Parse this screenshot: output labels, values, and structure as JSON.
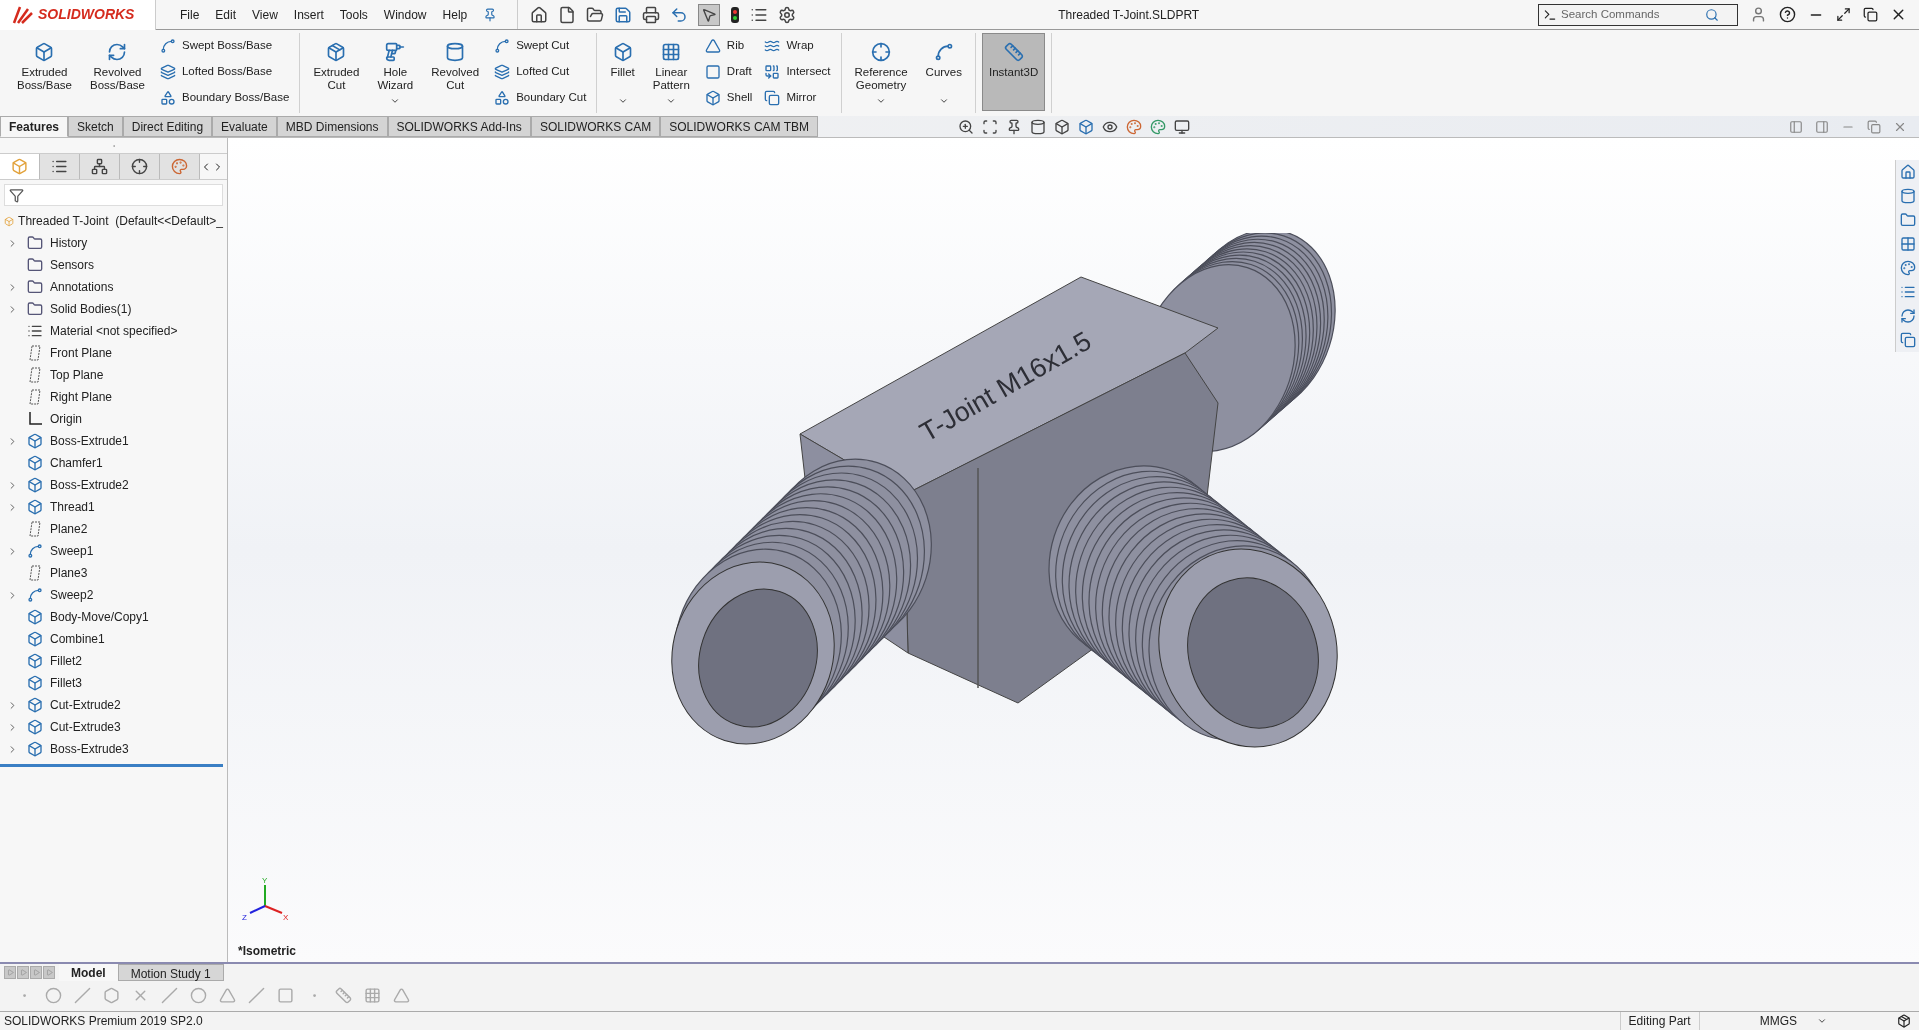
{
  "title_bar": {
    "logo_text": "SOLIDWORKS",
    "menus": [
      "File",
      "Edit",
      "View",
      "Insert",
      "Tools",
      "Window",
      "Help"
    ],
    "document_title": "Threaded T-Joint.SLDPRT",
    "search": {
      "placeholder": "Search Commands"
    }
  },
  "ribbon_groups": [
    [
      {
        "kind": "large",
        "label": "Extruded\nBoss/Base",
        "dropdown": false,
        "selected": false
      },
      {
        "kind": "large",
        "label": "Revolved\nBoss/Base",
        "dropdown": false,
        "selected": false
      },
      {
        "kind": "stack",
        "items": [
          "Swept Boss/Base",
          "Lofted Boss/Base",
          "Boundary Boss/Base"
        ]
      }
    ],
    [
      {
        "kind": "large",
        "label": "Extruded\nCut",
        "dropdown": false,
        "selected": false
      },
      {
        "kind": "large",
        "label": "Hole\nWizard",
        "dropdown": true,
        "selected": false
      },
      {
        "kind": "large",
        "label": "Revolved\nCut",
        "dropdown": false,
        "selected": false
      },
      {
        "kind": "stack",
        "items": [
          "Swept Cut",
          "Lofted Cut",
          "Boundary Cut"
        ]
      }
    ],
    [
      {
        "kind": "large",
        "label": "Fillet",
        "dropdown": true,
        "selected": false
      },
      {
        "kind": "large",
        "label": "Linear\nPattern",
        "dropdown": true,
        "selected": false
      },
      {
        "kind": "stack",
        "items": [
          "Rib",
          "Draft",
          "Shell"
        ]
      },
      {
        "kind": "stack",
        "items": [
          "Wrap",
          "Intersect",
          "Mirror"
        ]
      }
    ],
    [
      {
        "kind": "large",
        "label": "Reference\nGeometry",
        "dropdown": true,
        "selected": false
      },
      {
        "kind": "large",
        "label": "Curves",
        "dropdown": true,
        "selected": false
      }
    ],
    [
      {
        "kind": "large",
        "label": "Instant3D",
        "dropdown": false,
        "selected": true
      }
    ]
  ],
  "command_tabs": [
    {
      "label": "Features",
      "selected": true
    },
    {
      "label": "Sketch",
      "selected": false
    },
    {
      "label": "Direct Editing",
      "selected": false
    },
    {
      "label": "Evaluate",
      "selected": false
    },
    {
      "label": "MBD Dimensions",
      "selected": false
    },
    {
      "label": "SOLIDWORKS Add-Ins",
      "selected": false
    },
    {
      "label": "SOLIDWORKS CAM",
      "selected": false
    },
    {
      "label": "SOLIDWORKS CAM TBM",
      "selected": false
    }
  ],
  "feature_tree": {
    "panel_tabs": [
      {
        "selected": true
      },
      {
        "selected": false
      },
      {
        "selected": false
      },
      {
        "selected": false
      },
      {
        "selected": false
      }
    ],
    "root": "Threaded T-Joint  (Default<<Default>_",
    "items": [
      {
        "label": "History",
        "kind": "folder",
        "has_children": true
      },
      {
        "label": "Sensors",
        "kind": "folder",
        "has_children": false
      },
      {
        "label": "Annotations",
        "kind": "folder",
        "has_children": true
      },
      {
        "label": "Solid Bodies(1)",
        "kind": "folder",
        "has_children": true
      },
      {
        "label": "Material <not specified>",
        "kind": "material",
        "has_children": false
      },
      {
        "label": "Front Plane",
        "kind": "plane",
        "has_children": false
      },
      {
        "label": "Top Plane",
        "kind": "plane",
        "has_children": false
      },
      {
        "label": "Right Plane",
        "kind": "plane",
        "has_children": false
      },
      {
        "label": "Origin",
        "kind": "origin",
        "has_children": false
      },
      {
        "label": "Boss-Extrude1",
        "kind": "feature",
        "has_children": true
      },
      {
        "label": "Chamfer1",
        "kind": "feature",
        "has_children": false
      },
      {
        "label": "Boss-Extrude2",
        "kind": "feature",
        "has_children": true
      },
      {
        "label": "Thread1",
        "kind": "feature",
        "has_children": true
      },
      {
        "label": "Plane2",
        "kind": "plane",
        "has_children": false
      },
      {
        "label": "Sweep1",
        "kind": "sweep",
        "has_children": true
      },
      {
        "label": "Plane3",
        "kind": "plane",
        "has_children": false
      },
      {
        "label": "Sweep2",
        "kind": "sweep",
        "has_children": true
      },
      {
        "label": "Body-Move/Copy1",
        "kind": "feature",
        "has_children": false
      },
      {
        "label": "Combine1",
        "kind": "feature",
        "has_children": false
      },
      {
        "label": "Fillet2",
        "kind": "feature",
        "has_children": false
      },
      {
        "label": "Fillet3",
        "kind": "feature",
        "has_children": false
      },
      {
        "label": "Cut-Extrude2",
        "kind": "feature",
        "has_children": true
      },
      {
        "label": "Cut-Extrude3",
        "kind": "feature",
        "has_children": true
      },
      {
        "label": "Boss-Extrude3",
        "kind": "feature",
        "has_children": true
      }
    ]
  },
  "viewport": {
    "model_engraving": "T-Joint M16x1.5",
    "view_name": "*Isometric",
    "triad": [
      "Y",
      "Z",
      "X"
    ]
  },
  "bottom_tabs": [
    {
      "label": "Model",
      "selected": true
    },
    {
      "label": "Motion Study 1",
      "selected": false
    }
  ],
  "status_bar": {
    "product": "SOLIDWORKS Premium 2019 SP2.0",
    "mode": "Editing Part",
    "units": "MMGS"
  }
}
